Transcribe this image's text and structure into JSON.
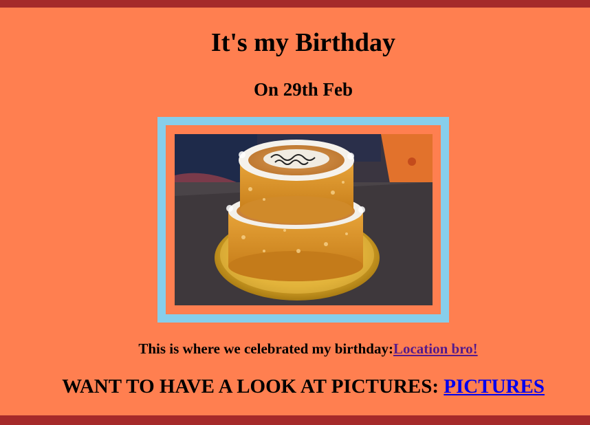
{
  "page": {
    "title": "It's my Birthday",
    "subtitle": "On 29th Feb"
  },
  "photo": {
    "subject": "two-tier birthday cake",
    "colors": {
      "frame_outer": "#87ceeb",
      "frame_inner": "#ff7f50",
      "background": "#ff7f50",
      "bars": "#a52a2a"
    }
  },
  "location": {
    "text": "This is where we celebrated my birthday:",
    "link_label": "Location bro!"
  },
  "pictures": {
    "text": "WANT TO HAVE A LOOK AT PICTURES: ",
    "link_label": "PICTURES"
  }
}
